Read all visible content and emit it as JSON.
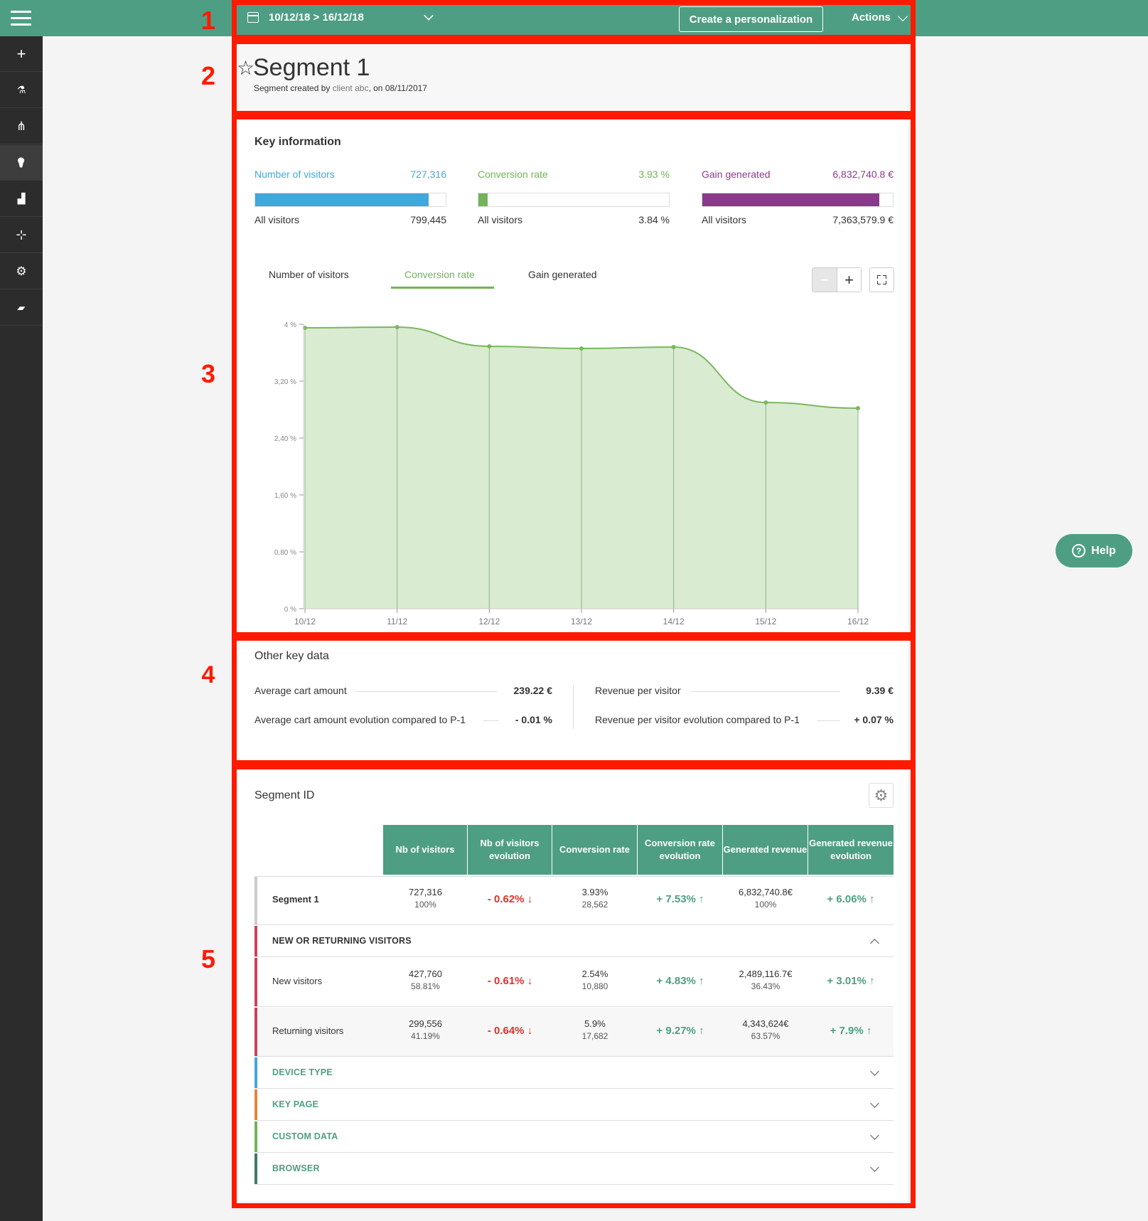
{
  "topbar": {
    "date_range": "10/12/18 > 16/12/18",
    "create_button": "Create a personalization",
    "actions_button": "Actions"
  },
  "sidebar": {
    "items": [
      {
        "icon": "plus-icon",
        "glyph": "+"
      },
      {
        "icon": "test-tube-icon",
        "glyph": "⚗"
      },
      {
        "icon": "hierarchy-icon",
        "glyph": "⋔"
      },
      {
        "icon": "lightbulb-icon",
        "glyph": "💡"
      },
      {
        "icon": "bar-chart-icon",
        "glyph": "▟"
      },
      {
        "icon": "target-icon",
        "glyph": "⊹"
      },
      {
        "icon": "gear-icon",
        "glyph": "⚙"
      },
      {
        "icon": "book-icon",
        "glyph": "▰"
      }
    ]
  },
  "annotations": [
    "1",
    "2",
    "3",
    "4",
    "5"
  ],
  "segment": {
    "title": "Segment 1",
    "sub_prefix": "Segment created by",
    "author": "client abc",
    "sub_mid": ", on",
    "date": "08/11/2017"
  },
  "key_information": {
    "title": "Key information",
    "metrics": [
      {
        "label": "Number of visitors",
        "value": "727,316",
        "fill": 0.91,
        "color": "#3fa8dc",
        "all_label": "All visitors",
        "all_value": "799,445"
      },
      {
        "label": "Conversion rate",
        "value": "3.93 %",
        "fill": 0.05,
        "color": "#73b359",
        "all_label": "All visitors",
        "all_value": "3.84 %"
      },
      {
        "label": "Gain generated",
        "value": "6,832,740.8 €",
        "fill": 0.93,
        "color": "#8b3a8b",
        "all_label": "All visitors",
        "all_value": "7,363,579.9 €"
      }
    ],
    "tabs": [
      "Number of visitors",
      "Conversion rate",
      "Gain generated"
    ],
    "active_tab": 1,
    "zoom_out": "−",
    "zoom_in": "+"
  },
  "chart_data": {
    "type": "area",
    "x": [
      "10/12",
      "11/12",
      "12/12",
      "13/12",
      "14/12",
      "15/12",
      "16/12"
    ],
    "values": [
      3.95,
      3.96,
      3.69,
      3.66,
      3.68,
      2.9,
      2.82
    ],
    "yticks": [
      "0 %",
      "0,80 %",
      "1,60 %",
      "2,40 %",
      "3,20 %",
      "4 %"
    ],
    "ylim": [
      0,
      4
    ],
    "color": "#7ab85d",
    "fill": "#d9ebd1"
  },
  "other_key_data": {
    "title": "Other key data",
    "items": [
      {
        "label": "Average cart amount",
        "value": "239.22 €"
      },
      {
        "label": "Average cart amount evolution compared to P-1",
        "value": "- 0.01 %"
      },
      {
        "label": "Revenue per visitor",
        "value": "9.39 €"
      },
      {
        "label": "Revenue per visitor evolution compared to P-1",
        "value": "+ 0.07 %"
      }
    ]
  },
  "segment_id": {
    "title": "Segment ID",
    "headers": [
      "Nb of visitors",
      "Nb of visitors evolution",
      "Conversion rate",
      "Conversion rate evolution",
      "Generated revenue",
      "Generated revenue evolution"
    ],
    "rows": [
      {
        "label": "Segment 1",
        "visitors": "727,316",
        "visitors_pct": "100%",
        "vis_evo": "- 0.62% ↓",
        "conv": "3.93%",
        "conv_n": "28,562",
        "conv_evo": "+ 7.53% ↑",
        "rev": "6,832,740.8€",
        "rev_pct": "100%",
        "rev_evo": "+ 6.06% ↑"
      },
      {
        "label": "New visitors",
        "visitors": "427,760",
        "visitors_pct": "58.81%",
        "vis_evo": "- 0.61% ↓",
        "conv": "2.54%",
        "conv_n": "10,880",
        "conv_evo": "+ 4.83% ↑",
        "rev": "2,489,116.7€",
        "rev_pct": "36.43%",
        "rev_evo": "+ 3.01% ↑"
      },
      {
        "label": "Returning visitors",
        "visitors": "299,556",
        "visitors_pct": "41.19%",
        "vis_evo": "- 0.64% ↓",
        "conv": "5.9%",
        "conv_n": "17,682",
        "conv_evo": "+ 9.27% ↑",
        "rev": "4,343,624€",
        "rev_pct": "63.57%",
        "rev_evo": "+ 7.9% ↑"
      }
    ],
    "groups": [
      {
        "label": "NEW OR RETURNING VISITORS",
        "color": "#cf3e5b",
        "text_color": "#333"
      },
      {
        "label": "DEVICE TYPE",
        "color": "#3fa8dc",
        "text_color": "#4e9e84"
      },
      {
        "label": "KEY PAGE",
        "color": "#e8833a",
        "text_color": "#4e9e84"
      },
      {
        "label": "CUSTOM DATA",
        "color": "#73b359",
        "text_color": "#4e9e84"
      },
      {
        "label": "BROWSER",
        "color": "#3d7a6a",
        "text_color": "#4e9e84"
      }
    ]
  },
  "help": {
    "label": "Help",
    "glyph": "?"
  }
}
